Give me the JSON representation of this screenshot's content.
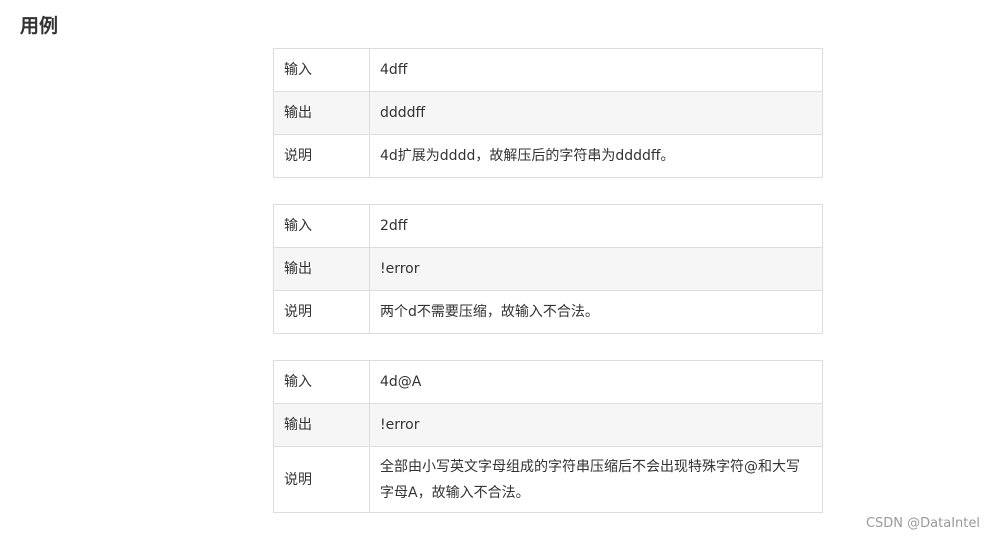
{
  "section_title": "用例",
  "examples": [
    {
      "rows": [
        {
          "key": "输入",
          "value": "4dff"
        },
        {
          "key": "输出",
          "value": "ddddff"
        },
        {
          "key": "说明",
          "value": "4d扩展为dddd，故解压后的字符串为ddddff。"
        }
      ]
    },
    {
      "rows": [
        {
          "key": "输入",
          "value": "2dff"
        },
        {
          "key": "输出",
          "value": "!error"
        },
        {
          "key": "说明",
          "value": "两个d不需要压缩，故输入不合法。"
        }
      ]
    },
    {
      "rows": [
        {
          "key": "输入",
          "value": "4d@A"
        },
        {
          "key": "输出",
          "value": "!error"
        },
        {
          "key": "说明",
          "value": "全部由小写英文字母组成的字符串压缩后不会出现特殊字符@和大写字母A，故输入不合法。"
        }
      ]
    }
  ],
  "watermark": "CSDN @DataIntel"
}
